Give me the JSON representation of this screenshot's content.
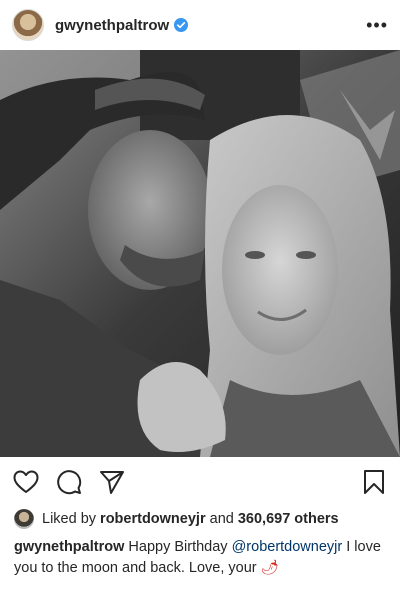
{
  "post": {
    "username": "gwynethpaltrow",
    "verified": true,
    "more_label": "•••"
  },
  "likes": {
    "prefix": "Liked by",
    "user": "robertdowneyjr",
    "joiner": "and",
    "count_text": "360,697 others"
  },
  "caption": {
    "username": "gwynethpaltrow",
    "text_before": "Happy Birthday",
    "mention": "@robertdowneyjr",
    "text_after": "I love you to the moon and back. Love, your",
    "emoji": "🌶"
  },
  "colors": {
    "verified_blue": "#3897f0",
    "mention_blue": "#003569",
    "text": "#262626"
  },
  "icons": [
    "heart-icon",
    "comment-icon",
    "share-icon",
    "bookmark-icon",
    "more-icon",
    "verified-badge-icon"
  ]
}
